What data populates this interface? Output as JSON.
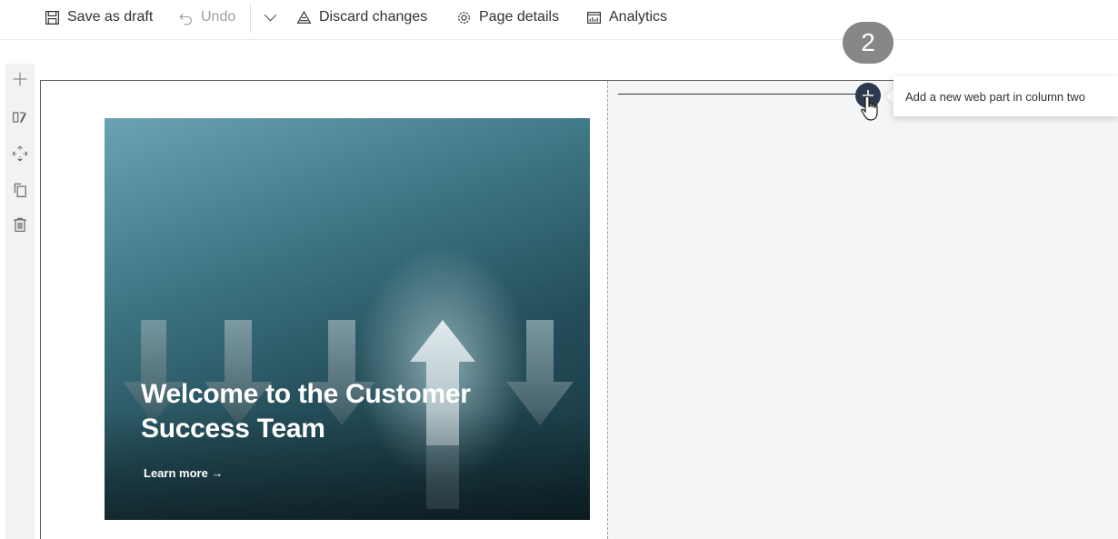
{
  "toolbar": {
    "save_label": "Save as draft",
    "undo_label": "Undo",
    "discard_label": "Discard changes",
    "page_details_label": "Page details",
    "analytics_label": "Analytics"
  },
  "icons": {
    "save": "save-icon",
    "undo": "undo-icon",
    "dropdown": "chevron-down-icon",
    "discard": "discard-icon",
    "page_details": "gear-icon",
    "analytics": "analytics-icon",
    "add_section": "plus-icon",
    "edit_section": "edit-section-icon",
    "move_section": "move-icon",
    "duplicate_section": "duplicate-icon",
    "delete_section": "delete-icon"
  },
  "hero": {
    "title": "Welcome to the Customer Success Team",
    "link": "Learn more →"
  },
  "add_webpart": {
    "tooltip": "Add a new web part in column two"
  },
  "step_badge": "2",
  "colors": {
    "canvas_bg": "#f4f5f7",
    "add_button": "#2b3a4e",
    "badge": "#878787"
  }
}
